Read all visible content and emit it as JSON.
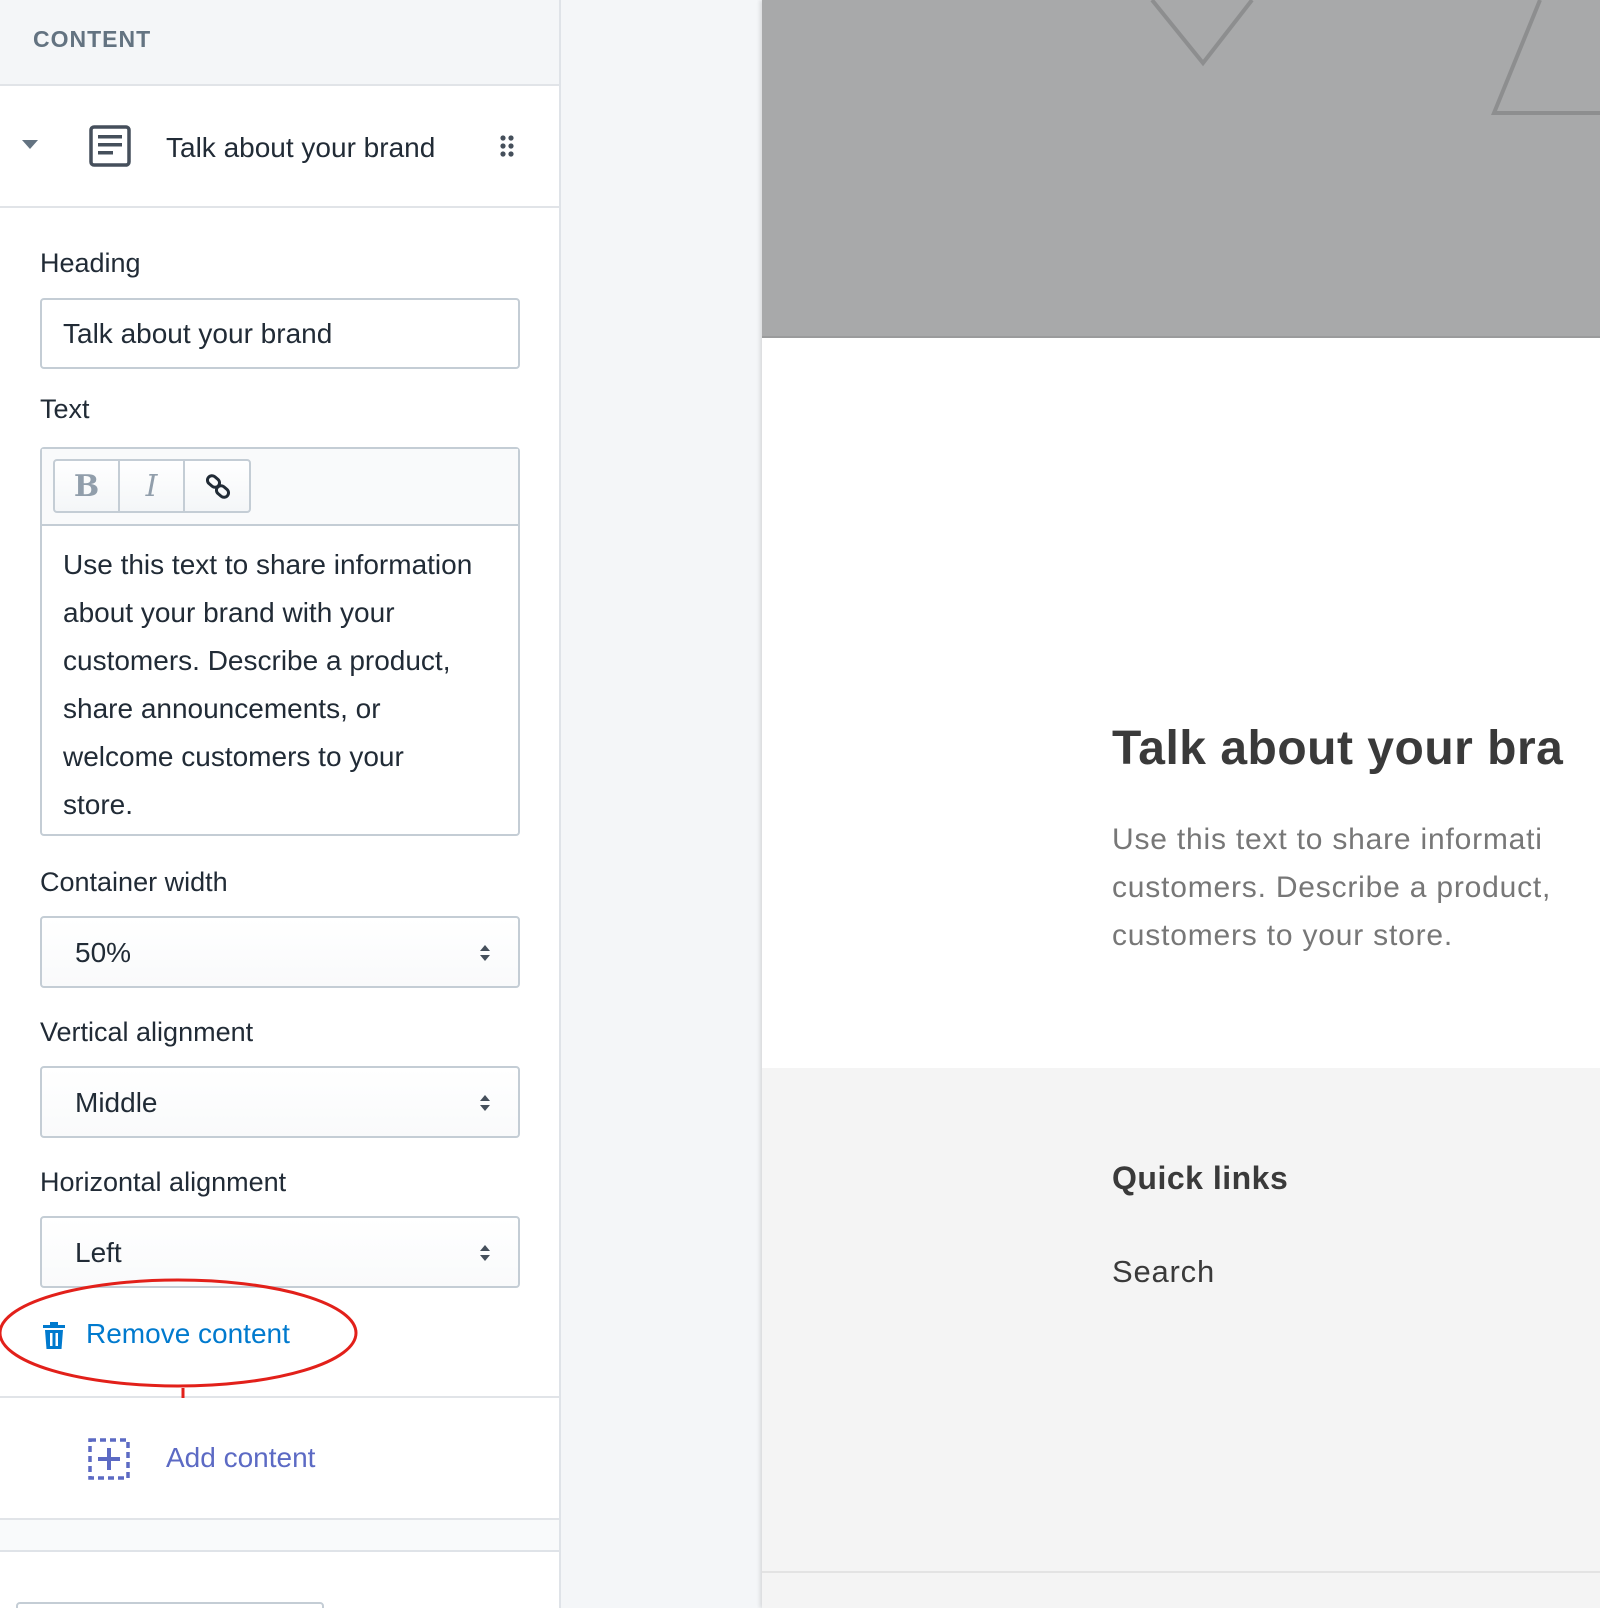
{
  "sidebar": {
    "section_title": "CONTENT",
    "block": {
      "title": "Talk about your brand",
      "icon": "text-block-icon",
      "drag_icon": "drag-handle-icon"
    },
    "fields": {
      "heading_label": "Heading",
      "heading_value": "Talk about your brand",
      "text_label": "Text",
      "toolbar": {
        "bold": "B",
        "italic": "I",
        "link_icon": "link-icon"
      },
      "text_lines": [
        "Use this text to share information",
        "about your brand with your",
        "customers. Describe a product,",
        "share announcements, or",
        "welcome customers to your",
        "store."
      ],
      "container_width_label": "Container width",
      "container_width_value": "50%",
      "vertical_alignment_label": "Vertical alignment",
      "vertical_alignment_value": "Middle",
      "horizontal_alignment_label": "Horizontal alignment",
      "horizontal_alignment_value": "Left"
    },
    "remove_label": "Remove content",
    "add_label": "Add content"
  },
  "preview": {
    "heading": "Talk about your bra",
    "body_lines": [
      "Use this text to share informati",
      "customers. Describe a product,",
      "customers to your store."
    ],
    "footer": {
      "quick_links_title": "Quick links",
      "links": [
        "Search"
      ]
    }
  },
  "colors": {
    "link_blue": "#007ace",
    "add_purple": "#5c6ac4",
    "annotation_red": "#e2201a",
    "image_placeholder_gray": "#a8a9aa"
  }
}
